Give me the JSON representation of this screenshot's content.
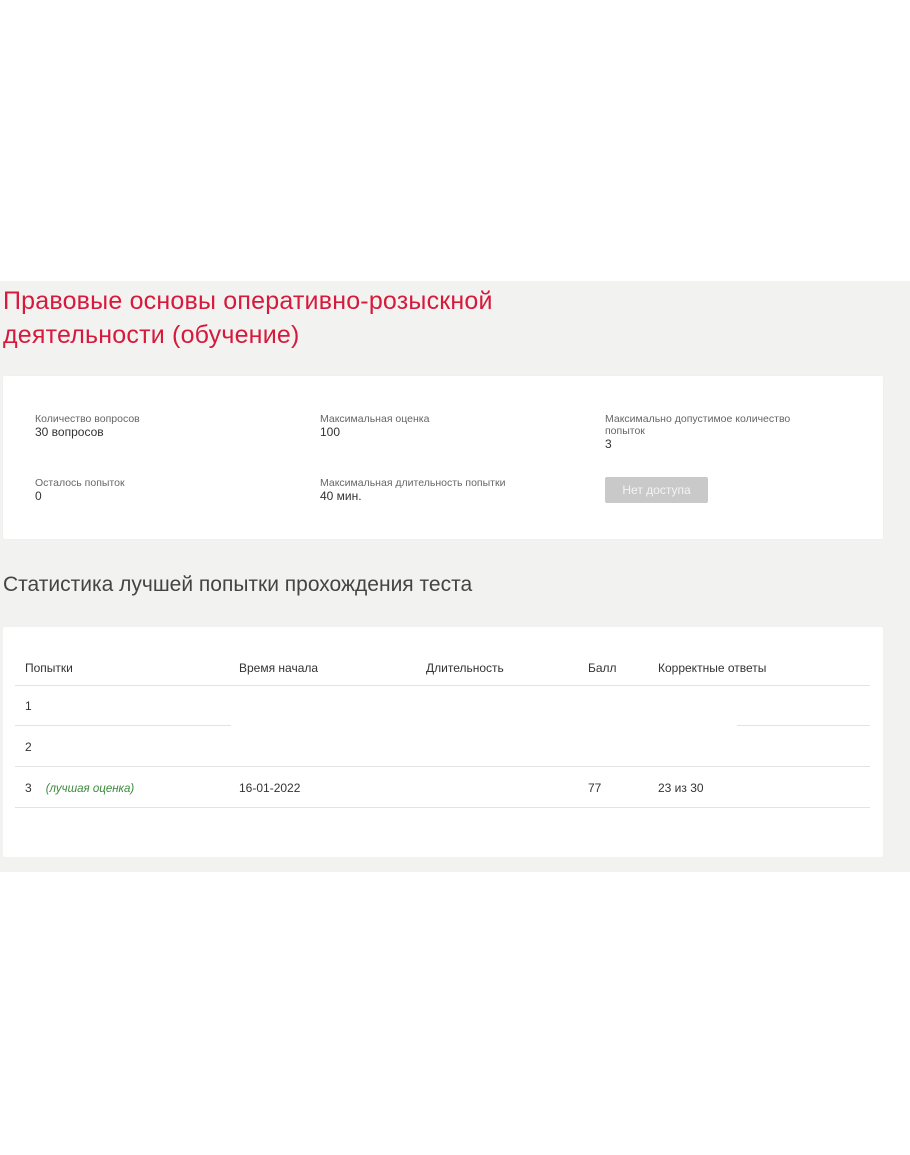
{
  "test": {
    "title": "Правовые основы оперативно-розыскной деятельности (обучение)"
  },
  "info": {
    "questions_count_label": "Количество вопросов",
    "questions_count_value": "30 вопросов",
    "max_score_label": "Максимальная оценка",
    "max_score_value": "100",
    "max_attempts_label": "Максимально допустимое количество попыток",
    "max_attempts_value": "3",
    "attempts_left_label": "Осталось попыток",
    "attempts_left_value": "0",
    "max_duration_label": "Максимальная длительность попытки",
    "max_duration_value": "40 мин.",
    "no_access_button": "Нет доступа"
  },
  "stats": {
    "heading": "Статистика лучшей попытки прохождения теста",
    "columns": [
      "Попытки",
      "Время начала",
      "Длительность",
      "Балл",
      "Корректные ответы"
    ],
    "rows": [
      {
        "attempt": "1",
        "note": "",
        "start": "",
        "duration": "",
        "score": "",
        "correct": ""
      },
      {
        "attempt": "2",
        "note": "",
        "start": "",
        "duration": "",
        "score": "",
        "correct": ""
      },
      {
        "attempt": "3",
        "note": "(лучшая оценка)",
        "start": "16-01-2022",
        "duration": "",
        "score": "77",
        "correct": "23 из 30"
      }
    ]
  },
  "colors": {
    "accent": "#d7193c",
    "background": "#f2f2f0",
    "best_note": "#3a8a3a",
    "disabled_button": "#c9c9c9"
  }
}
